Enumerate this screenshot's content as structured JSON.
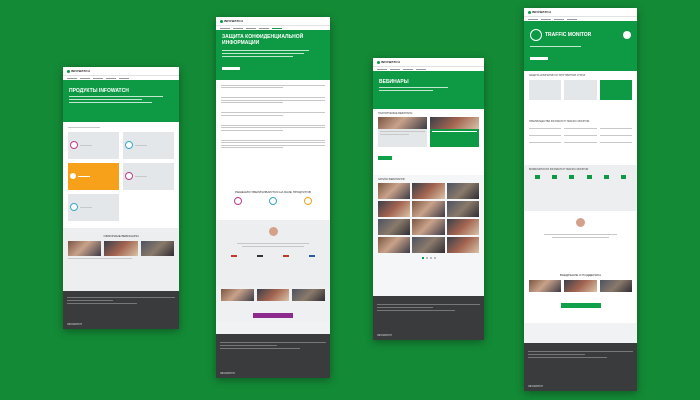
{
  "colors": {
    "background": "#138a36",
    "brand_green": "#0e9a45",
    "dark_footer": "#3a3b3d",
    "accent_purple": "#8e2a8d",
    "accent_orange": "#f7a11a",
    "tile_gray": "#e4e7ea"
  },
  "brand": "INFOWATCH",
  "pages": [
    {
      "hero_title": "ПРОДУКТЫ INFOWATCH",
      "section_title": "ОБЗОРНЫЕ ВЕБИНАРЫ"
    },
    {
      "hero_title": "ЗАЩИТА КОНФИДЕНЦИАЛЬНОЙ ИНФОРМАЦИИ",
      "section_title": "РЕШЕНИЯ УВЕЛИЧИВАЮТСЯ НА БАЗЕ ПРОДУКТОВ",
      "cta": "ЗАПИСАТЬСЯ НА ДЕМО-ВЕРСИЮ"
    },
    {
      "hero_title": "ВЕБИНАРЫ",
      "section_title": "ПЛАНИРУЕМЫЕ ВЕБИНАРЫ",
      "section_title2": "ЗАПИСИ ВЕБИНАРОВ"
    },
    {
      "hero_title": "TRAFFIC MONITOR",
      "section_title": "ЗАЩИТА КОМПАНИИ ОТ ВНУТРЕННИХ УГРОЗ",
      "section_title2": "ПРЕИМУЩЕСТВА INFOWATCH TRAFFIC MONITOR",
      "section_title3": "ВОЗМОЖНОСТИ INFOWATCH TRAFFIC MONITOR",
      "section_title4": "ВНЕДРЕНИЕ И ПОДДЕРЖКА",
      "cta": "ЗАПРОСИТЬ ДЕМОНСТРАЦИЮ"
    }
  ]
}
